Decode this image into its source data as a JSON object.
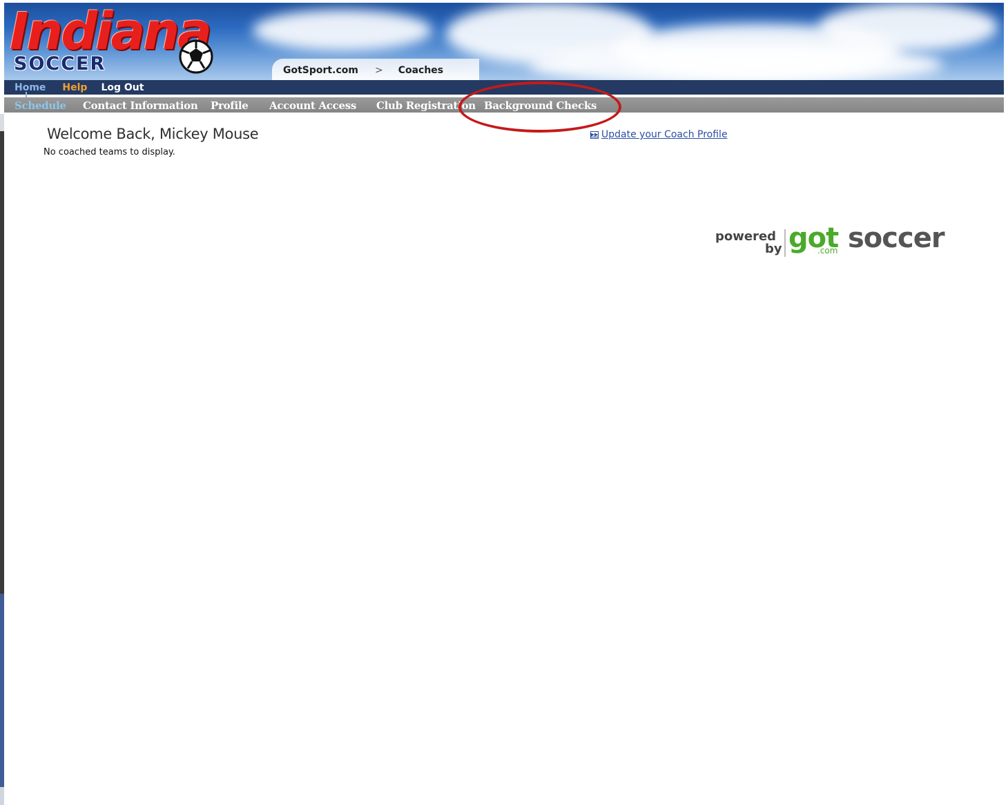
{
  "header": {
    "logo_title": "Indiana",
    "logo_subtitle": "SOCCER",
    "breadcrumb": {
      "root": "GotSport.com",
      "separator": ">",
      "current": "Coaches"
    }
  },
  "top_nav": {
    "home": "Home",
    "help": "Help",
    "logout": "Log Out"
  },
  "sub_nav": {
    "items": [
      "Schedule",
      "Contact Information",
      "Profile",
      "Account Access",
      "Club Registration",
      "Background Checks"
    ],
    "active": "Schedule",
    "highlighted": "Background Checks"
  },
  "main": {
    "welcome": "Welcome Back, Mickey Mouse",
    "no_teams": "No coached teams to display.",
    "update_link": "Update your Coach Profile"
  },
  "footer_logo": {
    "powered": "powered",
    "by": "by",
    "brand_got": "got",
    "brand_soccer": "soccer",
    "brand_com": ".com"
  },
  "colors": {
    "top_nav_bg": "#243a62",
    "sub_nav_bg": "#8f8f8f",
    "highlight_ring": "#c41a1a",
    "logo_red": "#e8201d",
    "link_blue": "#2b4fa5",
    "brand_green": "#4aaa2a"
  }
}
